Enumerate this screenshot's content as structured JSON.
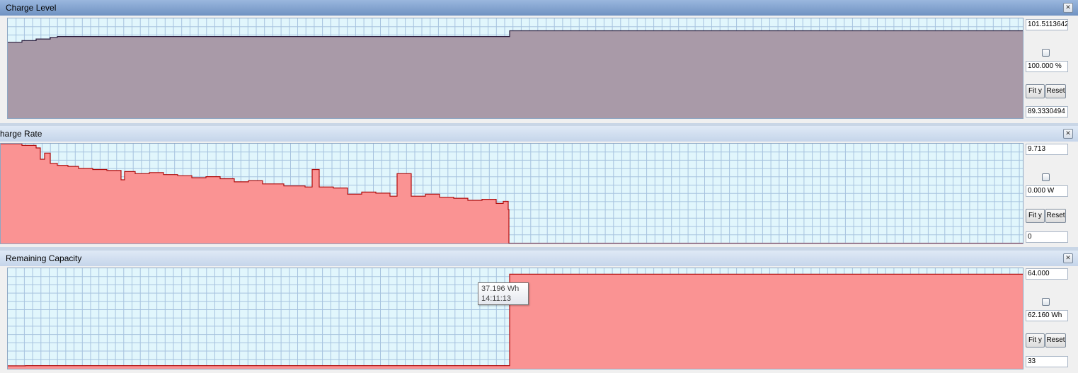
{
  "colors": {
    "plot_bg": "#e1f6fc",
    "grid": "#a7c3df",
    "level_fill": "#a99aa8",
    "level_line": "#2b1d3c",
    "rate_fill": "#fa9393",
    "rate_line": "#b00c0c"
  },
  "panels": [
    {
      "title": "Charge Level",
      "max_field": "101.5113642",
      "value_field": "100.000 %",
      "min_field": "89.3330494",
      "fit_label": "Fit y",
      "reset_label": "Reset"
    },
    {
      "title": "harge Rate",
      "max_field": "9.713",
      "value_field": "0.000 W",
      "min_field": "0",
      "fit_label": "Fit y",
      "reset_label": "Reset"
    },
    {
      "title": "Remaining Capacity",
      "max_field": "64.000",
      "value_field": "62.160 Wh",
      "min_field": "33",
      "fit_label": "Fit y",
      "reset_label": "Reset"
    }
  ],
  "tooltip": {
    "value": "37.196 Wh",
    "time": "14:11:13"
  },
  "chart_data": [
    {
      "type": "area",
      "title": "Charge Level",
      "ylim": [
        89.3330494,
        101.5113642
      ],
      "xlim": [
        0,
        1434
      ],
      "x": [
        0,
        20,
        40,
        60,
        70,
        708,
        709,
        1434
      ],
      "y": [
        98.6,
        98.8,
        99.0,
        99.2,
        99.3,
        99.3,
        100.0,
        100.0
      ]
    },
    {
      "type": "area",
      "title": "harge Rate",
      "ylim": [
        0,
        9.713
      ],
      "xlim": [
        0,
        1444
      ],
      "x": [
        0,
        30,
        50,
        56,
        62,
        70,
        80,
        95,
        110,
        130,
        150,
        170,
        175,
        190,
        210,
        230,
        250,
        270,
        290,
        310,
        330,
        350,
        370,
        400,
        430,
        440,
        450,
        470,
        490,
        510,
        530,
        550,
        560,
        580,
        600,
        620,
        640,
        660,
        680,
        700,
        710,
        717,
        718,
        1444
      ],
      "y": [
        9.7,
        9.55,
        9.3,
        8.2,
        8.8,
        7.8,
        7.6,
        7.5,
        7.3,
        7.2,
        7.1,
        6.2,
        7.0,
        6.8,
        6.9,
        6.7,
        6.6,
        6.4,
        6.5,
        6.3,
        6.0,
        6.1,
        5.8,
        5.6,
        5.5,
        7.2,
        5.5,
        5.4,
        4.8,
        5.0,
        4.9,
        4.6,
        6.8,
        4.6,
        4.8,
        4.5,
        4.4,
        4.2,
        4.3,
        3.9,
        4.1,
        3.3,
        0.0,
        0.0
      ]
    },
    {
      "type": "area",
      "title": "Remaining Capacity",
      "ylim": [
        33,
        64
      ],
      "xlim": [
        0,
        1434
      ],
      "x": [
        0,
        24,
        25,
        708,
        709,
        1434
      ],
      "y": [
        33.9,
        33.9,
        33.95,
        33.95,
        62.16,
        62.16
      ]
    }
  ]
}
